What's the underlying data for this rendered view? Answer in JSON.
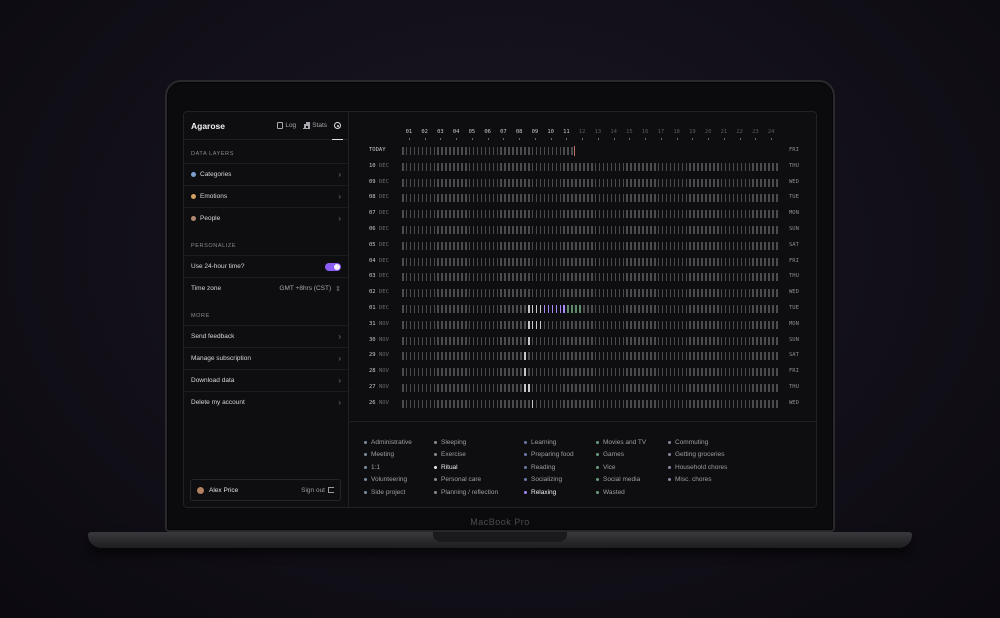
{
  "device": {
    "brand_label": "MacBook Pro"
  },
  "app": {
    "title": "Agarose",
    "nav": {
      "log_label": "Log",
      "stats_label": "Stats"
    }
  },
  "sidebar": {
    "data_layers": {
      "heading": "DATA LAYERS",
      "items": [
        {
          "label": "Categories",
          "icon": "categories-icon"
        },
        {
          "label": "Emotions",
          "icon": "emotions-icon"
        },
        {
          "label": "People",
          "icon": "people-icon"
        }
      ]
    },
    "personalize": {
      "heading": "PERSONALIZE",
      "use_24h_label": "Use 24-hour time?",
      "use_24h_value": true,
      "timezone_label": "Time zone",
      "timezone_value": "GMT +8hrs (CST)"
    },
    "more": {
      "heading": "MORE",
      "items": [
        "Send feedback",
        "Manage subscription",
        "Download data",
        "Delete my account"
      ]
    },
    "user": {
      "name": "Alex Price",
      "signout_label": "Sign out"
    }
  },
  "grid": {
    "hours": [
      "01",
      "02",
      "03",
      "04",
      "05",
      "06",
      "07",
      "08",
      "09",
      "10",
      "11",
      "12",
      "13",
      "14",
      "15",
      "16",
      "17",
      "18",
      "19",
      "20",
      "21",
      "22",
      "23",
      "24"
    ],
    "current_hour_index": 11,
    "rows": [
      {
        "label": "TODAY",
        "day": "",
        "month": "",
        "weekday": "FRI"
      },
      {
        "label": "",
        "day": "10",
        "month": "DEC",
        "weekday": "THU"
      },
      {
        "label": "",
        "day": "09",
        "month": "DEC",
        "weekday": "WED"
      },
      {
        "label": "",
        "day": "08",
        "month": "DEC",
        "weekday": "TUE"
      },
      {
        "label": "",
        "day": "07",
        "month": "DEC",
        "weekday": "MON"
      },
      {
        "label": "",
        "day": "06",
        "month": "DEC",
        "weekday": "SUN"
      },
      {
        "label": "",
        "day": "05",
        "month": "DEC",
        "weekday": "SAT"
      },
      {
        "label": "",
        "day": "04",
        "month": "DEC",
        "weekday": "FRI"
      },
      {
        "label": "",
        "day": "03",
        "month": "DEC",
        "weekday": "THU"
      },
      {
        "label": "",
        "day": "02",
        "month": "DEC",
        "weekday": "WED"
      },
      {
        "label": "",
        "day": "01",
        "month": "DEC",
        "weekday": "TUE"
      },
      {
        "label": "",
        "day": "31",
        "month": "NOV",
        "weekday": "MON"
      },
      {
        "label": "",
        "day": "30",
        "month": "NOV",
        "weekday": "SUN"
      },
      {
        "label": "",
        "day": "29",
        "month": "NOV",
        "weekday": "SAT"
      },
      {
        "label": "",
        "day": "28",
        "month": "NOV",
        "weekday": "FRI"
      },
      {
        "label": "",
        "day": "27",
        "month": "NOV",
        "weekday": "THU"
      },
      {
        "label": "",
        "day": "26",
        "month": "NOV",
        "weekday": "WED"
      }
    ]
  },
  "legend": {
    "columns": [
      [
        {
          "label": "Administrative",
          "color": "#7a8aa0",
          "highlight": false
        },
        {
          "label": "Meeting",
          "color": "#7a8aa0",
          "highlight": false
        },
        {
          "label": "1:1",
          "color": "#7a8aa0",
          "highlight": false
        },
        {
          "label": "Volunteering",
          "color": "#7a8aa0",
          "highlight": false
        },
        {
          "label": "Side project",
          "color": "#7a8aa0",
          "highlight": false
        }
      ],
      [
        {
          "label": "Sleeping",
          "color": "#8a8a90",
          "highlight": false
        },
        {
          "label": "Exercise",
          "color": "#8a8a90",
          "highlight": false
        },
        {
          "label": "Ritual",
          "color": "#e8e8ec",
          "highlight": true
        },
        {
          "label": "Personal care",
          "color": "#8a8a90",
          "highlight": false
        },
        {
          "label": "Planning / reflection",
          "color": "#8a8a90",
          "highlight": false
        }
      ],
      [
        {
          "label": "Learning",
          "color": "#6a7aa8",
          "highlight": false
        },
        {
          "label": "Preparing food",
          "color": "#6a7aa8",
          "highlight": false
        },
        {
          "label": "Reading",
          "color": "#6a7aa8",
          "highlight": false
        },
        {
          "label": "Socializing",
          "color": "#6a7aa8",
          "highlight": false
        },
        {
          "label": "Relaxing",
          "color": "#a78bfa",
          "highlight": true
        }
      ],
      [
        {
          "label": "Movies and TV",
          "color": "#6a9a80",
          "highlight": false
        },
        {
          "label": "Games",
          "color": "#6a9a80",
          "highlight": false
        },
        {
          "label": "Vice",
          "color": "#6a9a80",
          "highlight": false
        },
        {
          "label": "Social media",
          "color": "#6a9a80",
          "highlight": false
        },
        {
          "label": "Wasted",
          "color": "#6a9a80",
          "highlight": false
        }
      ],
      [
        {
          "label": "Commuting",
          "color": "#8a8aa0",
          "highlight": false
        },
        {
          "label": "Getting groceries",
          "color": "#8a8aa0",
          "highlight": false
        },
        {
          "label": "Household chores",
          "color": "#8a8aa0",
          "highlight": false
        },
        {
          "label": "Misc. chores",
          "color": "#8a8aa0",
          "highlight": false
        }
      ]
    ]
  },
  "colors": {
    "accent": "#8b5cf6",
    "cell_default": "#4a4a4f",
    "cell_ritual": "#c8c8cc",
    "cell_relaxing": "#a78bfa",
    "cell_green": "#5e8a6c",
    "now_line": "#c07060"
  }
}
